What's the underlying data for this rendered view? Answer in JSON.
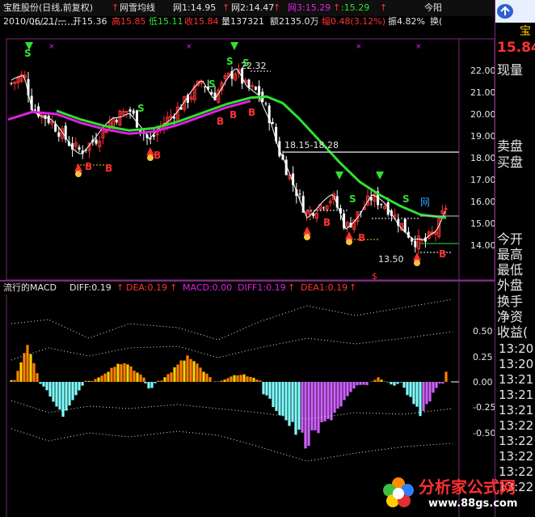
{
  "header": {
    "title": "宝胜股份(日线,前复权)",
    "indicator": "网雪均线",
    "w1": "网1:14.95",
    "w2": "网2:14.47",
    "w3": "网3:15.29",
    "w4": ":15.29",
    "today_label": "今阳"
  },
  "quote_line": {
    "date": "2010/06/21/一",
    "open": "开15.36",
    "high": "高15.85",
    "low": "低15.11",
    "close": "收15.84",
    "volume": "量137321",
    "amount": "额2135.0万",
    "change": "幅0.48(3.12%)",
    "amplitude": "振4.82%",
    "turnover": "换("
  },
  "price_axis": {
    "ticks": [
      "22.00",
      "21.00",
      "20.00",
      "19.00",
      "18.00",
      "17.00",
      "16.00",
      "15.00",
      "14.00"
    ]
  },
  "annotations": {
    "top_price": "22.32",
    "range": "18.15-18.28",
    "low_price": "13.50",
    "net_label": "网",
    "s_marker": "$"
  },
  "macd_header": {
    "name": "流行的MACD",
    "diff": "DIFF:0.19",
    "dea": "DEA:0.19",
    "macd": "MACD:0.00",
    "diff1": "DIFF1:0.19",
    "dea1": "DEA1:0.19"
  },
  "macd_axis": {
    "ticks": [
      "0.50",
      "0.25",
      "0.00",
      "-0.25",
      "-0.50"
    ]
  },
  "right_panel": {
    "name": "宝",
    "price": "15.84",
    "labels": [
      "现量",
      "卖盘",
      "买盘",
      "今开",
      "最高",
      "最低",
      "外盘",
      "换手",
      "净资",
      "收益("
    ],
    "times": [
      "13:20",
      "13:20",
      "13:21",
      "13:21",
      "13:21",
      "13:22",
      "13:22",
      "13:22",
      "13:22",
      "13:22"
    ]
  },
  "watermark": {
    "text": "分析家公式网",
    "url": "www.88gs.com"
  },
  "colors": {
    "up": "#ff3232",
    "down": "#ffffff",
    "ma_green": "#30e030",
    "ma_magenta": "#e020e0",
    "macd_pos_orange": "#ff8000",
    "macd_pos_yellow": "#ffd000",
    "macd_neg_cyan": "#80ffff",
    "macd_neg_magenta": "#d060ff"
  },
  "toolbar_icons": [
    "close-icon",
    "zoom-icon",
    "fit-icon",
    "arrow-up-icon",
    "arrow-down-icon",
    "pencil-icon",
    "cross-icon",
    "move-icon",
    "up-icon",
    "up-icon",
    "down-icon"
  ]
}
